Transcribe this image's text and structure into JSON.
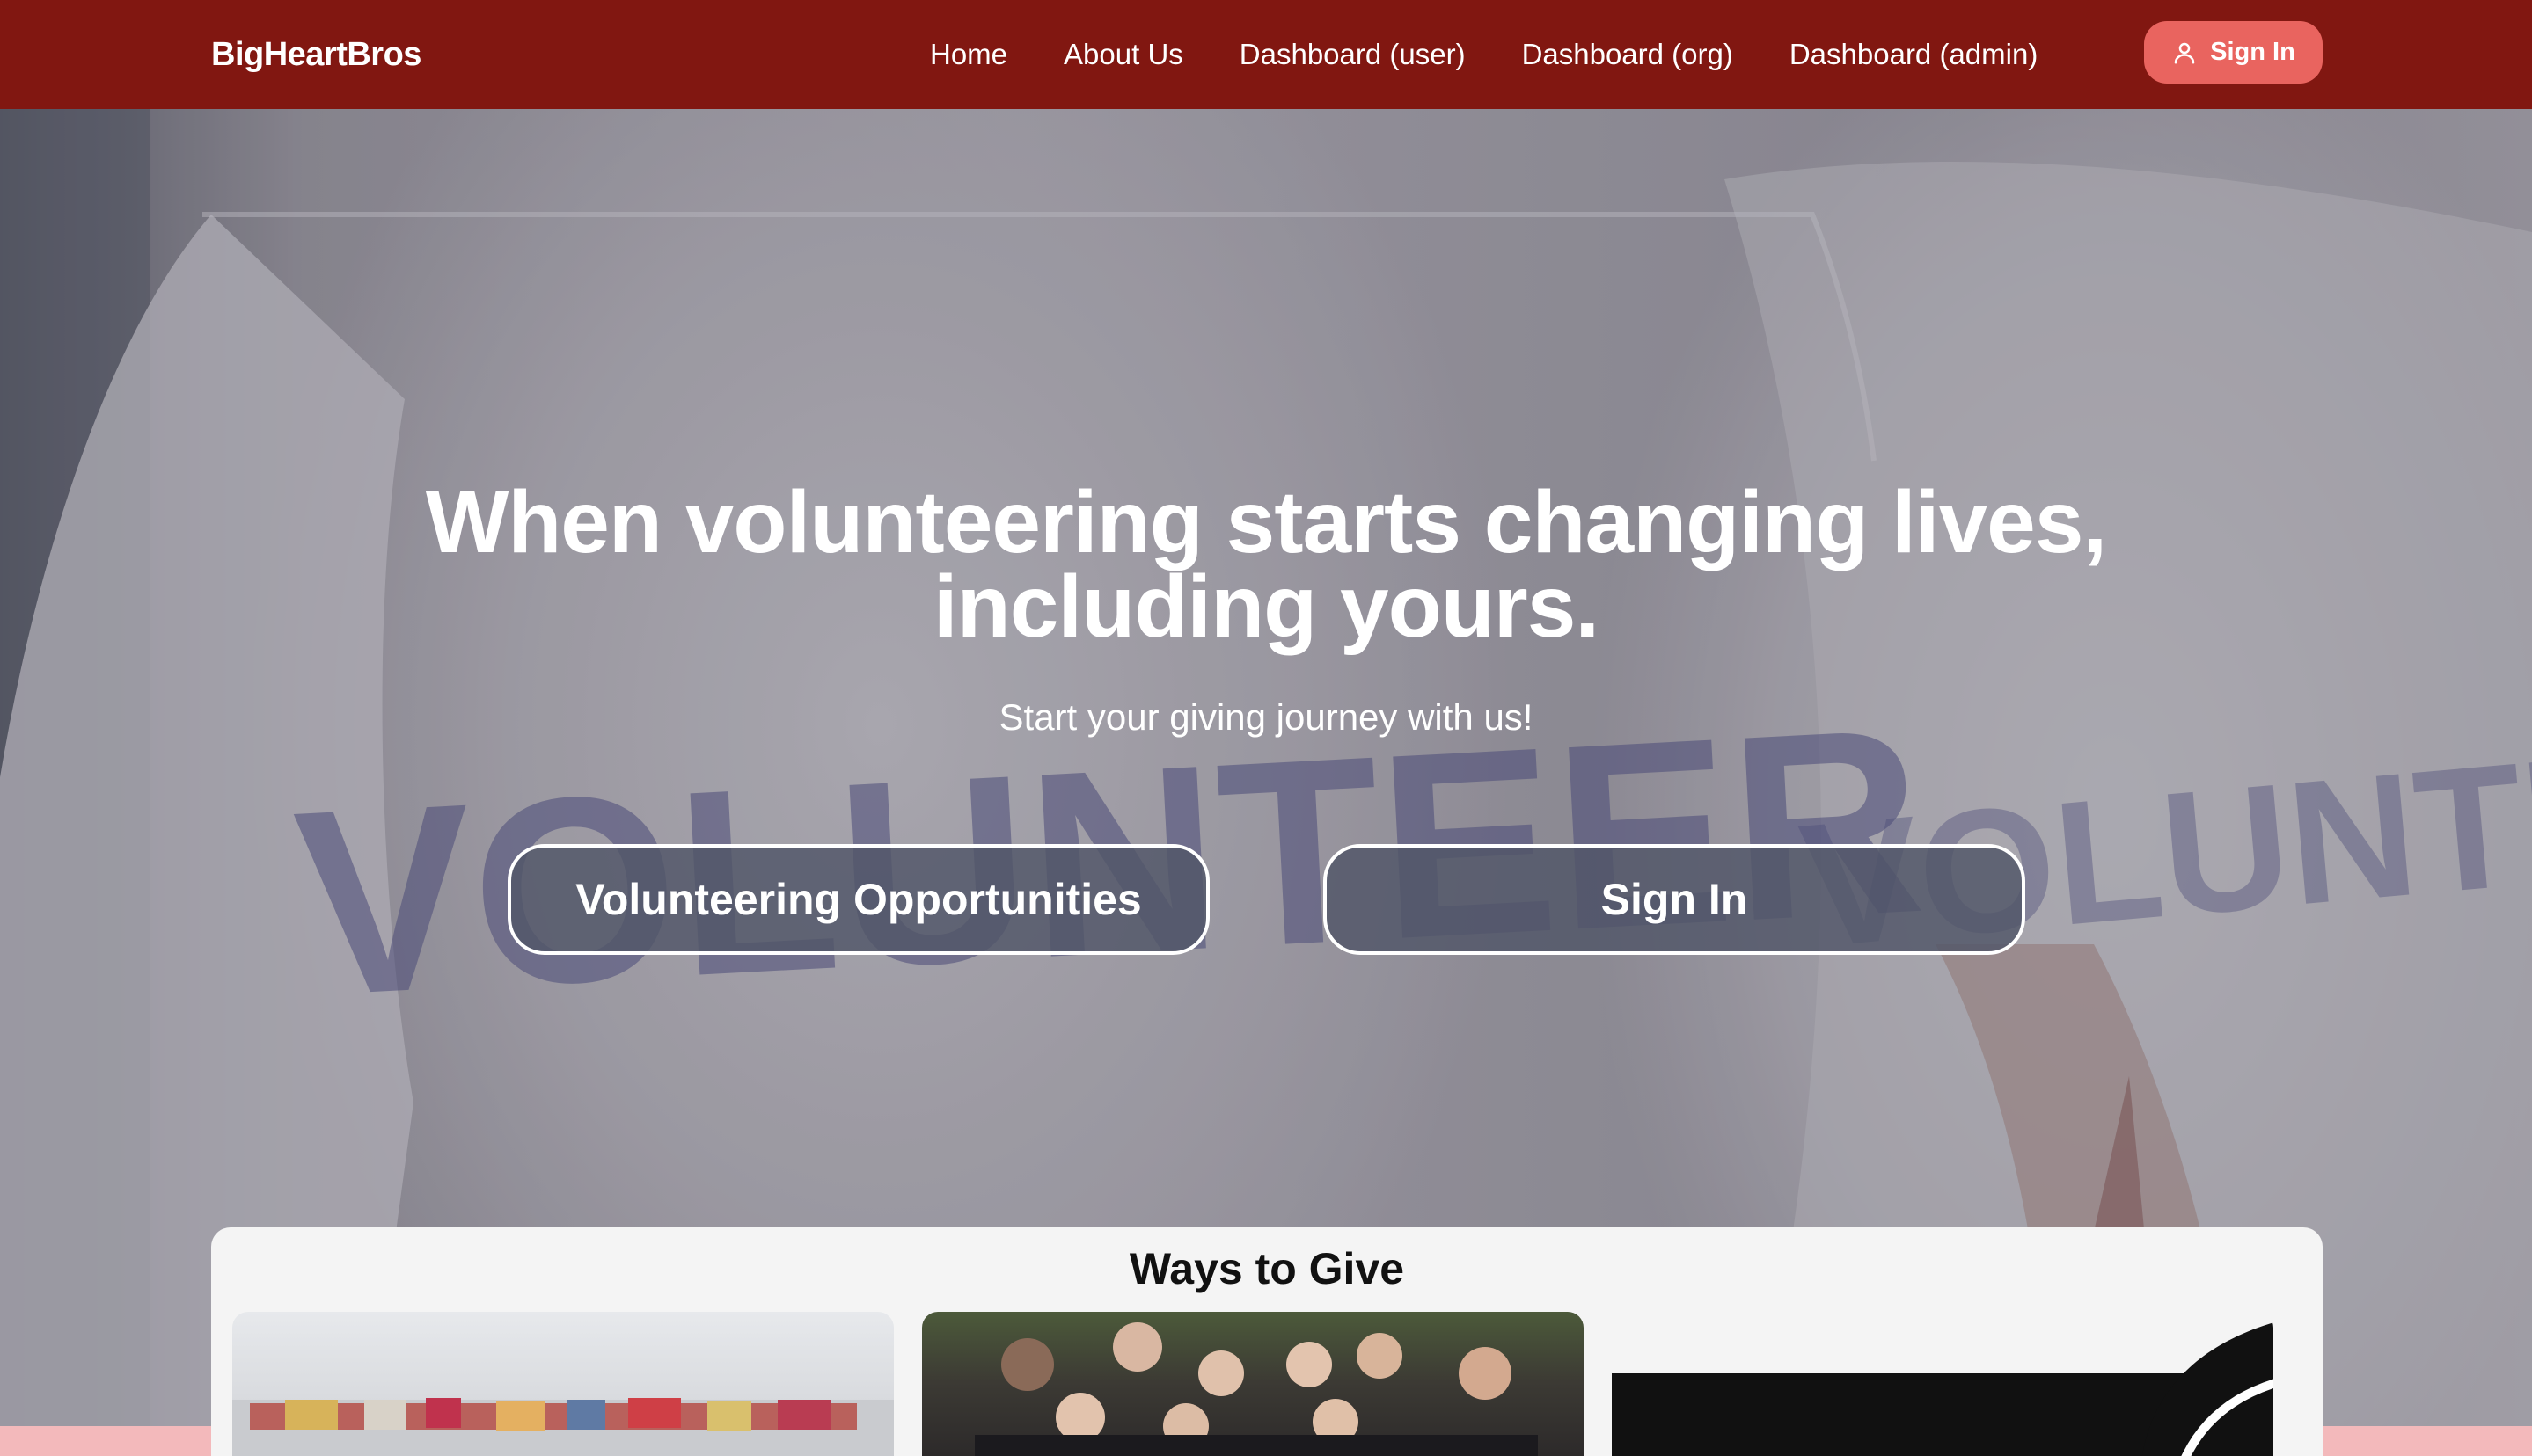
{
  "navbar": {
    "brand": "BigHeartBros",
    "links": [
      {
        "label": "Home"
      },
      {
        "label": "About Us"
      },
      {
        "label": "Dashboard (user)"
      },
      {
        "label": "Dashboard (org)"
      },
      {
        "label": "Dashboard (admin)"
      }
    ],
    "signin_label": "Sign In"
  },
  "hero": {
    "background_text": "VOLUNTEER",
    "title_line1": "When volunteering starts changing lives,",
    "title_line2": "including yours.",
    "subtitle": "Start your giving journey with us!",
    "primary_button": "Volunteering Opportunities",
    "secondary_button": "Sign In"
  },
  "ways": {
    "title": "Ways to Give"
  },
  "colors": {
    "navbar": "#811711",
    "accent": "#e9645f",
    "page_background": "#f3b9bb"
  },
  "icons": {
    "signin": "user-icon"
  }
}
